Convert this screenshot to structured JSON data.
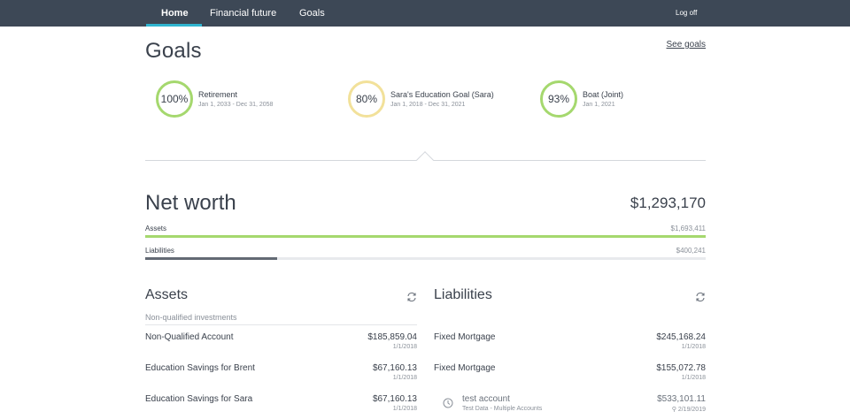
{
  "nav": {
    "items": [
      {
        "label": "Home"
      },
      {
        "label": "Financial future"
      },
      {
        "label": "Goals"
      }
    ],
    "logoff": "Log off"
  },
  "goals_section": {
    "title": "Goals",
    "see_goals": "See goals",
    "goals": [
      {
        "percent": "100%",
        "name": "Retirement",
        "dates": "Jan 1, 2033 - Dec 31, 2058",
        "color": "#a5d86e"
      },
      {
        "percent": "80%",
        "name": "Sara's Education Goal (Sara)",
        "dates": "Jan 1, 2018 - Dec 31, 2021",
        "color": "#f2e19a"
      },
      {
        "percent": "93%",
        "name": "Boat (Joint)",
        "dates": "Jan 1, 2021",
        "color": "#a5d86e"
      }
    ]
  },
  "net_worth": {
    "title": "Net worth",
    "value": "$1,293,170",
    "assets": {
      "label": "Assets",
      "value": "$1,693,411",
      "fill_fraction": 1.0,
      "color": "#a5d86e"
    },
    "liabilities": {
      "label": "Liabilities",
      "value": "$400,241",
      "fill_fraction": 0.236,
      "color": "#636a74"
    }
  },
  "assets": {
    "title": "Assets",
    "subhead": "Non-qualified investments",
    "rows": [
      {
        "name": "Non-Qualified Account",
        "amount": "$185,859.04",
        "date": "1/1/2018"
      },
      {
        "name": "Education Savings for Brent",
        "amount": "$67,160.13",
        "date": "1/1/2018"
      },
      {
        "name": "Education Savings for Sara",
        "amount": "$67,160.13",
        "date": "1/1/2018"
      }
    ]
  },
  "liabilities": {
    "title": "Liabilities",
    "rows": [
      {
        "name": "Fixed Mortgage",
        "amount": "$245,168.24",
        "date": "1/1/2018"
      },
      {
        "name": "Fixed Mortgage",
        "amount": "$155,072.78",
        "date": "1/1/2018"
      },
      {
        "name": "test account",
        "sub": "Test Data - Multiple Accounts",
        "amount": "$533,101.11",
        "date": "2/19/2019"
      }
    ]
  },
  "colors": {
    "nav_bg": "#3d4856",
    "nav_accent": "#2fb4cf"
  }
}
